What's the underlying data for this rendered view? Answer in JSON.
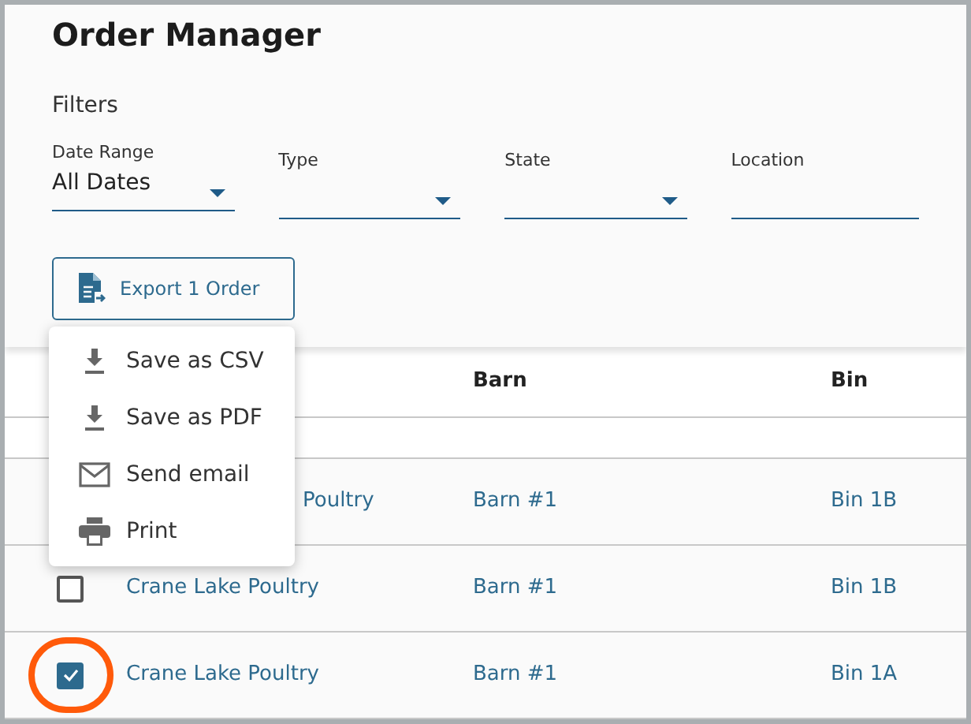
{
  "title": "Order Manager",
  "filters": {
    "heading": "Filters",
    "fields": [
      {
        "label": "Date Range",
        "value": "All Dates",
        "dropdown": true
      },
      {
        "label": "Type",
        "dropdown": true
      },
      {
        "label": "State",
        "dropdown": true
      },
      {
        "label": "Location",
        "dropdown": false
      }
    ]
  },
  "export_button": {
    "label": "Export 1 Order"
  },
  "export_menu": [
    {
      "label": "Save as CSV",
      "kind": "download"
    },
    {
      "label": "Save as PDF",
      "kind": "download"
    },
    {
      "label": "Send email",
      "kind": "email"
    },
    {
      "label": "Print",
      "kind": "print"
    }
  ],
  "table": {
    "columns": [
      "Barn",
      "Bin"
    ],
    "rows": [
      {
        "kind": "covered",
        "client": "Poultry",
        "barn": "Barn #1",
        "bin": "Bin 1B"
      },
      {
        "kind": "full",
        "client": "Crane Lake Poultry",
        "barn": "Barn #1",
        "bin": "Bin 1B",
        "checked": false
      },
      {
        "kind": "full",
        "client": "Crane Lake Poultry",
        "barn": "Barn #1",
        "bin": "Bin 1A",
        "checked": true,
        "highlighted": true
      }
    ]
  }
}
